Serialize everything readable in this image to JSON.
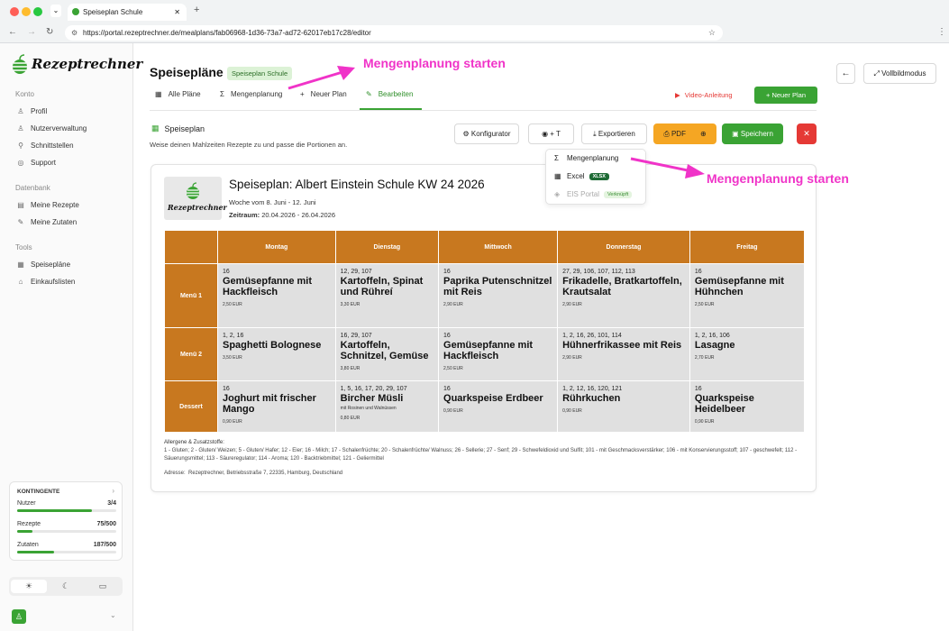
{
  "browser": {
    "tab_title": "Speiseplan Schule",
    "url": "https://portal.rezeptrechner.de/mealplans/fab06968-1d36-73a7-ad72-62017eb17c28/editor",
    "new_tab": "+"
  },
  "sidebar": {
    "brand": "Rezeptrechner",
    "sections": [
      {
        "label": "Konto",
        "items": [
          {
            "label": "Profil",
            "icon": "user-icon"
          },
          {
            "label": "Nutzerverwaltung",
            "icon": "users-icon"
          },
          {
            "label": "Schnittstellen",
            "icon": "plug-icon"
          },
          {
            "label": "Support",
            "icon": "support-icon"
          }
        ]
      },
      {
        "label": "Datenbank",
        "items": [
          {
            "label": "Meine Rezepte",
            "icon": "book-icon"
          },
          {
            "label": "Meine Zutaten",
            "icon": "carrot-icon"
          }
        ]
      },
      {
        "label": "Tools",
        "items": [
          {
            "label": "Speisepläne",
            "icon": "calendar-icon"
          },
          {
            "label": "Einkaufslisten",
            "icon": "basket-icon"
          }
        ]
      }
    ],
    "quota": {
      "title": "KONTINGENTE",
      "rows": [
        {
          "label": "Nutzer",
          "value": "3/4",
          "fill": 0.75
        },
        {
          "label": "Rezepte",
          "value": "75/500",
          "fill": 0.15
        },
        {
          "label": "Zutaten",
          "value": "187/500",
          "fill": 0.374
        }
      ]
    }
  },
  "header": {
    "title": "Speisepläne",
    "badge": "Speiseplan Schule",
    "fullscreen": "Vollbildmodus",
    "tabs": [
      {
        "label": "Alle Pläne",
        "icon": "calendar-icon"
      },
      {
        "label": "Mengenplanung",
        "icon": "sigma-icon"
      },
      {
        "label": "Neuer Plan",
        "icon": "plus-icon"
      },
      {
        "label": "Bearbeiten",
        "icon": "pencil-icon"
      }
    ],
    "video": "Video-Anleitung",
    "new_plan": "+ Neuer Plan"
  },
  "editor": {
    "heading": "Speiseplan",
    "subtitle": "Weise deinen Mahlzeiten Rezepte zu und passe die Portionen an.",
    "toolbar": {
      "konfigurator": "Konfigurator",
      "style": "+ T",
      "export": "Exportieren",
      "pdf": "PDF",
      "save": "Speichern",
      "close": "✕"
    },
    "dropdown": [
      {
        "label": "Mengenplanung",
        "tag": ""
      },
      {
        "label": "Excel",
        "tag": "XLSX"
      },
      {
        "label": "EIS Portal",
        "tag": "Verknüpft"
      }
    ]
  },
  "plan": {
    "logo_text": "Rezeptrechner",
    "title": "Speiseplan: Albert Einstein Schule KW 24 2026",
    "week": "Woche vom 8. Juni - 12. Juni",
    "period_label": "Zeitraum:",
    "period": "20.04.2026 - 26.04.2026",
    "days": [
      "Montag",
      "Dienstag",
      "Mittwoch",
      "Donnerstag",
      "Freitag"
    ],
    "rows": [
      {
        "label": "Menü 1",
        "cells": [
          {
            "al": "16",
            "name": "Gemüsepfanne mit Hackfleisch",
            "extra": "",
            "price": "2,50 EUR"
          },
          {
            "al": "12, 29, 107",
            "name": "Kartoffeln, Spinat und Rühreí",
            "extra": "",
            "price": "3,30 EUR"
          },
          {
            "al": "16",
            "name": "Paprika Putenschnitzel mit Reis",
            "extra": "",
            "price": "2,90 EUR"
          },
          {
            "al": "27, 29, 106, 107, 112, 113",
            "name": "Frikadelle, Bratkartoffeln, Krautsalat",
            "extra": "",
            "price": "2,90 EUR"
          },
          {
            "al": "16",
            "name": "Gemüsepfanne mit Hühnchen",
            "extra": "",
            "price": "2,50 EUR"
          }
        ]
      },
      {
        "label": "Menü 2",
        "cells": [
          {
            "al": "1, 2, 16",
            "name": "Spaghetti Bolognese",
            "extra": "",
            "price": "3,50 EUR"
          },
          {
            "al": "16, 29, 107",
            "name": "Kartoffeln, Schnitzel, Gemüse",
            "extra": "",
            "price": "3,80 EUR"
          },
          {
            "al": "16",
            "name": "Gemüsepfanne mit Hackfleisch",
            "extra": "",
            "price": "2,50 EUR"
          },
          {
            "al": "1, 2, 16, 26, 101, 114",
            "name": "Hühnerfrikassee mit Reis",
            "extra": "",
            "price": "2,90 EUR"
          },
          {
            "al": "1, 2, 16, 106",
            "name": "Lasagne",
            "extra": "",
            "price": "2,70 EUR"
          }
        ]
      },
      {
        "label": "Dessert",
        "cells": [
          {
            "al": "16",
            "name": "Joghurt mit frischer Mango",
            "extra": "",
            "price": "0,90 EUR"
          },
          {
            "al": "1, 5, 16, 17, 20, 29, 107",
            "name": "Bircher Müsli",
            "extra": "mit Rosinen und Walnüssen",
            "price": "0,80 EUR"
          },
          {
            "al": "16",
            "name": "Quarkspeise Erdbeer",
            "extra": "",
            "price": "0,90 EUR"
          },
          {
            "al": "1, 2, 12, 16, 120, 121",
            "name": "Rührkuchen",
            "extra": "",
            "price": "0,90 EUR"
          },
          {
            "al": "16",
            "name": "Quarkspeise Heidelbeer",
            "extra": "",
            "price": "0,90 EUR"
          }
        ]
      }
    ],
    "allergen_title": "Allergene & Zusatzstoffe:",
    "allergen_text": "1 - Gluten; 2 - Gluten/ Weizen; 5 - Gluten/ Hafer; 12 - Eier; 16 - Milch; 17 - Schalenfrüchte; 20 - Schalenfrüchte/ Walnuss; 26 - Sellerie; 27 - Senf; 29 - Schwefeldioxid und Sulfit; 101 - mit Geschmacksverstärker; 106 - mit Konservierungsstoff; 107 - geschwefelt; 112 - Säuerungsmittel; 113 - Säureregulator; 114 - Aroma; 120 - Backtriebmittel; 121 - Geliermittel",
    "address_label": "Adresse:",
    "address": "Rezeptrechner, Betriebsstraße 7, 22335, Hamburg, Deutschland"
  },
  "annotations": [
    "Mengenplanung starten",
    "Mengenplanung starten"
  ],
  "colors": {
    "brand_green": "#3aa334",
    "orange": "#c8781f",
    "pdf_yellow": "#f5a623",
    "danger": "#e53935",
    "annotation": "#f033c8"
  }
}
